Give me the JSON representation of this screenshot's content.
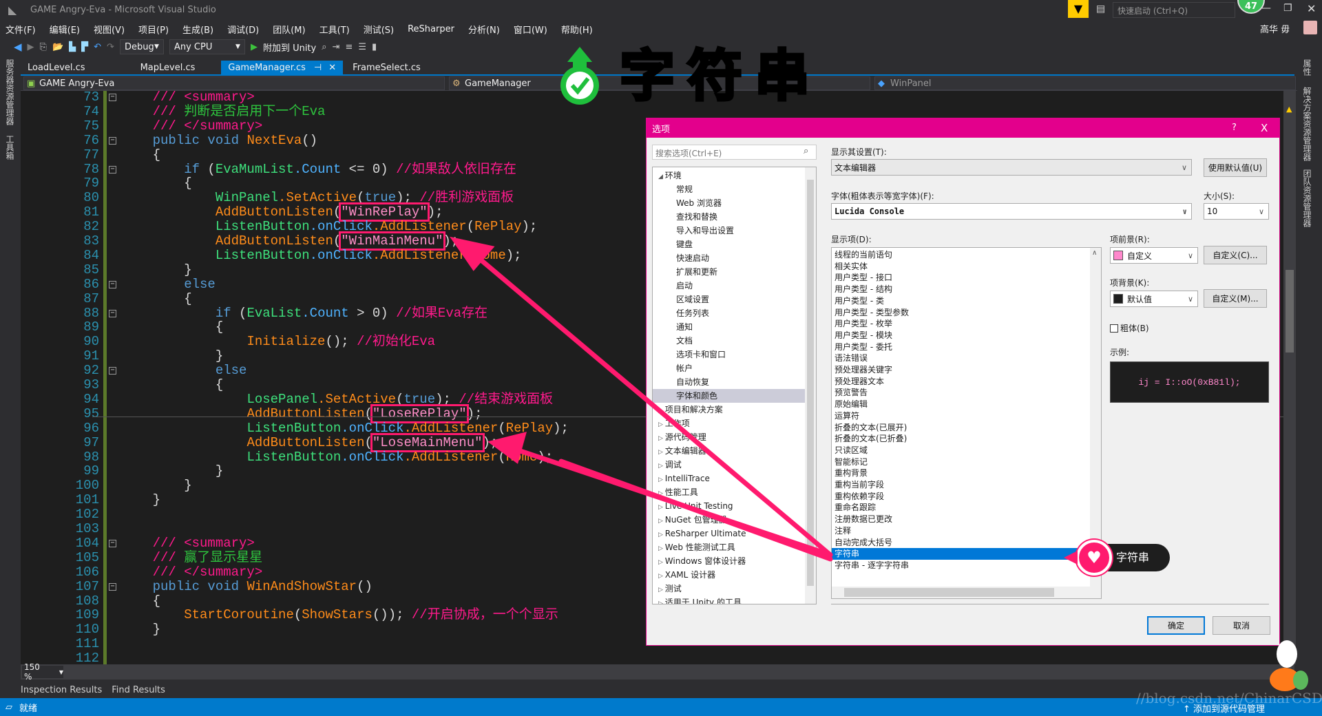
{
  "window": {
    "title": "GAME  Angry-Eva - Microsoft Visual Studio",
    "quick_launch_placeholder": "快速启动 (Ctrl+Q)",
    "notification_count": "47",
    "user_name": "高华 毋"
  },
  "menu": [
    "文件(F)",
    "编辑(E)",
    "视图(V)",
    "项目(P)",
    "生成(B)",
    "调试(D)",
    "团队(M)",
    "工具(T)",
    "测试(S)",
    "ReSharper",
    "分析(N)",
    "窗口(W)",
    "帮助(H)"
  ],
  "toolbar": {
    "config": "Debug",
    "platform": "Any CPU",
    "attach": "附加到 Unity"
  },
  "tabs": [
    {
      "label": "LoadLevel.cs"
    },
    {
      "label": "MapLevel.cs"
    },
    {
      "label": "GameManager.cs",
      "active": true
    },
    {
      "label": "FrameSelect.cs"
    }
  ],
  "navbar": {
    "project": "GAME  Angry-Eva",
    "class": "GameManager",
    "member": "WinPanel"
  },
  "side_left": [
    "服务器资源管理器",
    "工具箱"
  ],
  "side_right": [
    "属性",
    "解决方案资源管理器",
    "团队资源管理器"
  ],
  "editor": {
    "zoom": "150 %",
    "lines": [
      {
        "n": "73",
        "fold": true,
        "t": [
          [
            "    /// ",
            "cm"
          ],
          [
            "<summary>",
            "cm"
          ]
        ]
      },
      {
        "n": "74",
        "t": [
          [
            "    /// ",
            "cm"
          ],
          [
            "判断是否启用下一个Eva",
            "doc"
          ]
        ]
      },
      {
        "n": "75",
        "t": [
          [
            "    /// ",
            "cm"
          ],
          [
            "</summary>",
            "cm"
          ]
        ]
      },
      {
        "n": "76",
        "fold": true,
        "t": [
          [
            "    public void ",
            "kw"
          ],
          [
            "NextEva",
            "mth"
          ],
          [
            "()",
            "pn"
          ]
        ]
      },
      {
        "n": "77",
        "t": [
          [
            "    {",
            "pn"
          ]
        ]
      },
      {
        "n": "78",
        "fold": true,
        "t": [
          [
            "        if ",
            "kw"
          ],
          [
            "(",
            "pn"
          ],
          [
            "EvaMumList",
            "cls"
          ],
          [
            ".Count",
            "prop"
          ],
          [
            " <= 0) ",
            "pn"
          ],
          [
            "//如果敌人依旧存在",
            "cm"
          ]
        ]
      },
      {
        "n": "79",
        "t": [
          [
            "        {",
            "pn"
          ]
        ]
      },
      {
        "n": "80",
        "t": [
          [
            "            ",
            "pn"
          ],
          [
            "WinPanel",
            "cls"
          ],
          [
            ".SetActive",
            "mth"
          ],
          [
            "(",
            "pn"
          ],
          [
            "true",
            "kw"
          ],
          [
            "); ",
            "pn"
          ],
          [
            "//胜利游戏面板",
            "cm"
          ]
        ]
      },
      {
        "n": "81",
        "t": [
          [
            "            ",
            "pn"
          ],
          [
            "AddButtonListen",
            "mth"
          ],
          [
            "(",
            "pn"
          ],
          [
            "\"WinRePlay\"",
            "hl"
          ],
          [
            ");",
            "pn"
          ]
        ]
      },
      {
        "n": "82",
        "t": [
          [
            "            ",
            "pn"
          ],
          [
            "ListenButton",
            "cls"
          ],
          [
            ".onClick",
            "prop"
          ],
          [
            ".AddListener",
            "mth"
          ],
          [
            "(",
            "pn"
          ],
          [
            "RePlay",
            "mth"
          ],
          [
            ");",
            "pn"
          ]
        ]
      },
      {
        "n": "83",
        "t": [
          [
            "            ",
            "pn"
          ],
          [
            "AddButtonListen",
            "mth"
          ],
          [
            "(",
            "pn"
          ],
          [
            "\"WinMainMenu\"",
            "hl"
          ],
          [
            ");",
            "pn"
          ]
        ]
      },
      {
        "n": "84",
        "t": [
          [
            "            ",
            "pn"
          ],
          [
            "ListenButton",
            "cls"
          ],
          [
            ".onClick",
            "prop"
          ],
          [
            ".AddListener",
            "mth"
          ],
          [
            "(",
            "pn"
          ],
          [
            "Home",
            "mth"
          ],
          [
            ");",
            "pn"
          ]
        ]
      },
      {
        "n": "85",
        "t": [
          [
            "        }",
            "pn"
          ]
        ]
      },
      {
        "n": "86",
        "fold": true,
        "t": [
          [
            "        else",
            "kw"
          ]
        ]
      },
      {
        "n": "87",
        "t": [
          [
            "        {",
            "pn"
          ]
        ]
      },
      {
        "n": "88",
        "fold": true,
        "t": [
          [
            "            if ",
            "kw"
          ],
          [
            "(",
            "pn"
          ],
          [
            "EvaList",
            "cls"
          ],
          [
            ".Count",
            "prop"
          ],
          [
            " > 0) ",
            "pn"
          ],
          [
            "//如果Eva存在",
            "cm"
          ]
        ]
      },
      {
        "n": "89",
        "t": [
          [
            "            {",
            "pn"
          ]
        ]
      },
      {
        "n": "90",
        "t": [
          [
            "                ",
            "pn"
          ],
          [
            "Initialize",
            "mth"
          ],
          [
            "(); ",
            "pn"
          ],
          [
            "//初始化Eva",
            "cm"
          ]
        ]
      },
      {
        "n": "91",
        "t": [
          [
            "            }",
            "pn"
          ]
        ]
      },
      {
        "n": "92",
        "fold": true,
        "t": [
          [
            "            else",
            "kw"
          ]
        ]
      },
      {
        "n": "93",
        "t": [
          [
            "            {",
            "pn"
          ]
        ]
      },
      {
        "n": "94",
        "t": [
          [
            "                ",
            "pn"
          ],
          [
            "LosePanel",
            "cls"
          ],
          [
            ".SetActive",
            "mth"
          ],
          [
            "(",
            "pn"
          ],
          [
            "true",
            "kw"
          ],
          [
            "); ",
            "pn"
          ],
          [
            "//结束游戏面板",
            "cm"
          ]
        ]
      },
      {
        "n": "95",
        "t": [
          [
            "                ",
            "pn"
          ],
          [
            "AddButtonListen",
            "mth"
          ],
          [
            "(",
            "pn"
          ],
          [
            "\"LoseRePlay\"",
            "hl"
          ],
          [
            ");",
            "pn"
          ]
        ]
      },
      {
        "n": "96",
        "t": [
          [
            "                ",
            "pn"
          ],
          [
            "ListenButton",
            "cls"
          ],
          [
            ".onClick",
            "prop"
          ],
          [
            ".AddListener",
            "mth"
          ],
          [
            "(",
            "pn"
          ],
          [
            "RePlay",
            "mth"
          ],
          [
            ");",
            "pn"
          ]
        ]
      },
      {
        "n": "97",
        "t": [
          [
            "                ",
            "pn"
          ],
          [
            "AddButtonListen",
            "mth"
          ],
          [
            "(",
            "pn"
          ],
          [
            "\"LoseMainMenu\"",
            "hl"
          ],
          [
            ");",
            "pn"
          ]
        ]
      },
      {
        "n": "98",
        "t": [
          [
            "                ",
            "pn"
          ],
          [
            "ListenButton",
            "cls"
          ],
          [
            ".onClick",
            "prop"
          ],
          [
            ".AddListener",
            "mth"
          ],
          [
            "(",
            "pn"
          ],
          [
            "Home",
            "mth"
          ],
          [
            ");",
            "pn"
          ]
        ]
      },
      {
        "n": "99",
        "t": [
          [
            "            }",
            "pn"
          ]
        ]
      },
      {
        "n": "100",
        "t": [
          [
            "        }",
            "pn"
          ]
        ]
      },
      {
        "n": "101",
        "t": [
          [
            "    }",
            "pn"
          ]
        ]
      },
      {
        "n": "102",
        "t": []
      },
      {
        "n": "103",
        "t": []
      },
      {
        "n": "104",
        "fold": true,
        "t": [
          [
            "    /// ",
            "cm"
          ],
          [
            "<summary>",
            "cm"
          ]
        ]
      },
      {
        "n": "105",
        "t": [
          [
            "    /// ",
            "cm"
          ],
          [
            "赢了显示星星",
            "doc"
          ]
        ]
      },
      {
        "n": "106",
        "t": [
          [
            "    /// ",
            "cm"
          ],
          [
            "</summary>",
            "cm"
          ]
        ]
      },
      {
        "n": "107",
        "fold": true,
        "t": [
          [
            "    public void ",
            "kw"
          ],
          [
            "WinAndShowStar",
            "mth"
          ],
          [
            "()",
            "pn"
          ]
        ]
      },
      {
        "n": "108",
        "t": [
          [
            "    {",
            "pn"
          ]
        ]
      },
      {
        "n": "109",
        "t": [
          [
            "        ",
            "pn"
          ],
          [
            "StartCoroutine",
            "mth"
          ],
          [
            "(",
            "pn"
          ],
          [
            "ShowStars",
            "mth"
          ],
          [
            "()); ",
            "pn"
          ],
          [
            "//开启协成，一个个显示",
            "cm"
          ]
        ]
      },
      {
        "n": "110",
        "t": [
          [
            "    }",
            "pn"
          ]
        ]
      },
      {
        "n": "111",
        "t": []
      },
      {
        "n": "112",
        "t": []
      }
    ]
  },
  "bottom_tabs": [
    "Inspection Results",
    "Find Results"
  ],
  "status": {
    "text": "就绪",
    "right": "添加到源代码管理"
  },
  "overlay": {
    "headline": "字符串",
    "callout": "字符串",
    "watermark": "//blog.csdn.net/ChinarCSDN",
    "colors": {
      "arrow": "#ff1a6e",
      "headline": "#1ee61e"
    }
  },
  "dialog": {
    "title": "选项",
    "help": "?",
    "close": "X",
    "search_placeholder": "搜索选项(Ctrl+E)",
    "tree": [
      {
        "label": "环境",
        "expanded": true,
        "level": 0
      },
      {
        "label": "常规",
        "level": 1
      },
      {
        "label": "Web 浏览器",
        "level": 1
      },
      {
        "label": "查找和替换",
        "level": 1
      },
      {
        "label": "导入和导出设置",
        "level": 1
      },
      {
        "label": "键盘",
        "level": 1
      },
      {
        "label": "快速启动",
        "level": 1
      },
      {
        "label": "扩展和更新",
        "level": 1
      },
      {
        "label": "启动",
        "level": 1
      },
      {
        "label": "区域设置",
        "level": 1
      },
      {
        "label": "任务列表",
        "level": 1
      },
      {
        "label": "通知",
        "level": 1
      },
      {
        "label": "文档",
        "level": 1
      },
      {
        "label": "选项卡和窗口",
        "level": 1
      },
      {
        "label": "帐户",
        "level": 1
      },
      {
        "label": "自动恢复",
        "level": 1
      },
      {
        "label": "字体和颜色",
        "level": 1,
        "selected": true
      },
      {
        "label": "项目和解决方案",
        "level": 0
      },
      {
        "label": "工作项",
        "level": 0
      },
      {
        "label": "源代码管理",
        "level": 0
      },
      {
        "label": "文本编辑器",
        "level": 0
      },
      {
        "label": "调试",
        "level": 0
      },
      {
        "label": "IntelliTrace",
        "level": 0
      },
      {
        "label": "性能工具",
        "level": 0
      },
      {
        "label": "Live Unit Testing",
        "level": 0
      },
      {
        "label": "NuGet 包管理器",
        "level": 0
      },
      {
        "label": "ReSharper Ultimate",
        "level": 0
      },
      {
        "label": "Web 性能测试工具",
        "level": 0
      },
      {
        "label": "Windows 窗体设计器",
        "level": 0
      },
      {
        "label": "XAML 设计器",
        "level": 0
      },
      {
        "label": "测试",
        "level": 0
      },
      {
        "label": "适用于 Unity 的工具",
        "level": 0
      }
    ],
    "show_settings_label": "显示其设置(T):",
    "show_settings_value": "文本编辑器",
    "use_defaults": "使用默认值(U)",
    "font_label": "字体(粗体表示等宽字体)(F):",
    "font_value": "Lucida Console",
    "size_label": "大小(S):",
    "size_value": "10",
    "display_items_label": "显示项(D):",
    "display_items": [
      "线程的当前语句",
      "相关实体",
      "用户类型 - 接口",
      "用户类型 - 结构",
      "用户类型 - 类",
      "用户类型 - 类型参数",
      "用户类型 - 枚举",
      "用户类型 - 模块",
      "用户类型 - 委托",
      "语法错误",
      "预处理器关键字",
      "预处理器文本",
      "预览警告",
      "原始编辑",
      "运算符",
      "折叠的文本(已展开)",
      "折叠的文本(已折叠)",
      "只读区域",
      "智能标记",
      "重构背景",
      "重构当前字段",
      "重构依赖字段",
      "重命名跟踪",
      "注册数据已更改",
      "注释",
      "自动完成大括号",
      "字符串",
      "字符串 - 逐字字符串"
    ],
    "selected_item": "字符串",
    "fg_label": "项前景(R):",
    "fg_value": "自定义",
    "fg_color": "#ff88cc",
    "fg_custom": "自定义(C)...",
    "bg_label": "项背景(K):",
    "bg_value": "默认值",
    "bg_color": "#1e1e1e",
    "bg_custom": "自定义(M)...",
    "bold_label": "粗体(B)",
    "bold_checked": false,
    "sample_label": "示例:",
    "sample_text": "ij = I::oO(0xB81l);",
    "ok": "确定",
    "cancel": "取消"
  }
}
